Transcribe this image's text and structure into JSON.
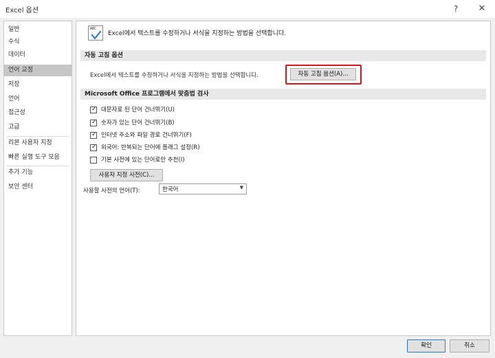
{
  "window": {
    "title": "Excel 옵션",
    "help_label": "?",
    "close_label": "✕"
  },
  "sidebar": {
    "items": [
      {
        "label": "일반"
      },
      {
        "label": "수식"
      },
      {
        "label": "데이터"
      },
      {
        "label": "언어 교정",
        "selected": true
      },
      {
        "label": "저장"
      },
      {
        "label": "언어"
      },
      {
        "label": "접근성"
      },
      {
        "label": "고급"
      },
      {
        "label": "리본 사용자 지정"
      },
      {
        "label": "빠른 실행 도구 모음"
      },
      {
        "label": "추가 기능"
      },
      {
        "label": "보안 센터"
      }
    ]
  },
  "main": {
    "intro_icon": {
      "name": "abc-checkmark-icon",
      "text": "ABC"
    },
    "intro_text": "Excel에서 텍스트를 수정하거나 서식을 지정하는 방법을 선택합니다.",
    "autocorrect": {
      "header": "자동 고침 옵션",
      "description": "Excel에서 텍스트를 수정하거나 서식을 지정하는 방법을 선택합니다.",
      "button_label": "자동 고침 옵션(A)..."
    },
    "spelling": {
      "header": "Microsoft Office 프로그램에서 맞춤법 검사",
      "options": [
        {
          "label": "대문자로 된 단어 건너뛰기(U)",
          "checked": true
        },
        {
          "label": "숫자가 있는 단어 건너뛰기(B)",
          "checked": true
        },
        {
          "label": "인터넷 주소와 파일 경로 건너뛰기(F)",
          "checked": true
        },
        {
          "label": "외국어: 반복되는 단어에 플래그 설정(R)",
          "checked": true
        },
        {
          "label": "기본 사전에 있는 단어로만 추천(I)",
          "checked": false
        }
      ],
      "custom_dict_button": "사용자 지정 사전(C)...",
      "dict_lang_label": "사용할 사전의 언어(T):",
      "dict_lang_value": "한국어"
    }
  },
  "footer": {
    "ok_label": "확인",
    "cancel_label": "취소"
  },
  "colors": {
    "highlight": "#d9151c",
    "selected_nav": "#c6c6c6",
    "default_button_border": "#2a7bd0"
  }
}
